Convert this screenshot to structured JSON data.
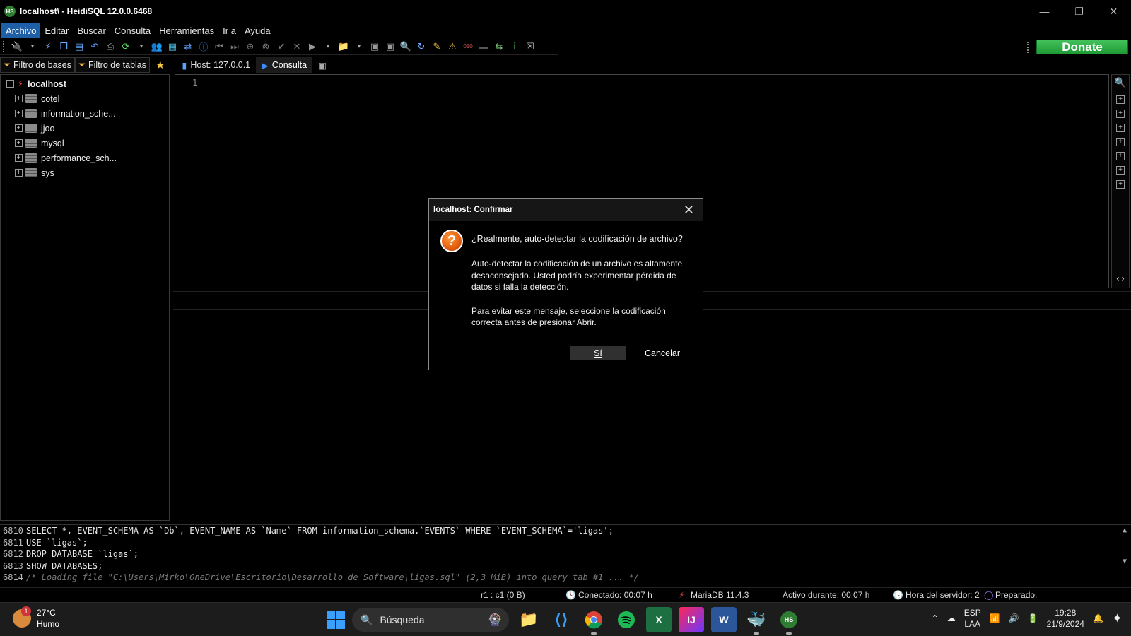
{
  "window": {
    "title": "localhost\\ - HeidiSQL 12.0.0.6468",
    "app_logo": "HS",
    "minimize": "—",
    "maximize": "❐",
    "close": "✕"
  },
  "menu": [
    "Archivo",
    "Editar",
    "Buscar",
    "Consulta",
    "Herramientas",
    "Ir a",
    "Ayuda"
  ],
  "toolbar": {
    "icons": [
      "connect-icon",
      "disconnect-icon",
      "copy-icon",
      "paste-icon",
      "undo-icon",
      "print-icon",
      "refresh-icon",
      "users-icon",
      "export-icon",
      "sync-icon",
      "help-icon",
      "first-icon",
      "last-icon",
      "add-icon",
      "cancel-icon",
      "apply-icon",
      "delete-icon",
      "run-icon",
      "open-folder-icon",
      "save-icon",
      "search-icon",
      "replace-icon",
      "clean-icon",
      "warning-icon"
    ],
    "donate_label": "Donate"
  },
  "tabs": {
    "filter_databases": "Filtro de bases",
    "filter_tables": "Filtro de tablas",
    "host_tab": "Host: 127.0.0.1",
    "query_tab": "Consulta"
  },
  "tree": {
    "host": "localhost",
    "databases": [
      "cotel",
      "information_sche...",
      "jjoo",
      "mysql",
      "performance_sch...",
      "sys"
    ]
  },
  "editor": {
    "line_number": "1"
  },
  "log": [
    {
      "num": "6810",
      "text": "SELECT *, EVENT_SCHEMA AS `Db`, EVENT_NAME AS `Name` FROM information_schema.`EVENTS` WHERE `EVENT_SCHEMA`='ligas';"
    },
    {
      "num": "6811",
      "text": "USE `ligas`;"
    },
    {
      "num": "6812",
      "text": "DROP DATABASE `ligas`;"
    },
    {
      "num": "6813",
      "text": "SHOW DATABASES;"
    },
    {
      "num": "6814",
      "text": "/* Loading file \"C:\\Users\\Mirko\\OneDrive\\Escritorio\\Desarrollo de Software\\ligas.sql\" (2,3 MiB) into query tab #1 ... */"
    }
  ],
  "status": {
    "cursor": "r1 : c1 (0 B)",
    "connected": "Conectado: 00:07 h",
    "server": "MariaDB 11.4.3",
    "uptime": "Activo durante: 00:07 h",
    "server_time": "Hora del servidor: 2",
    "state": "Preparado."
  },
  "dialog": {
    "title": "localhost: Confirmar",
    "question": "¿Realmente, auto-detectar la codificación de archivo?",
    "body1": "Auto-detectar la codificación de un archivo es altamente desaconsejado. Usted podría experimentar pérdida de datos si falla la detección.",
    "body2": "Para evitar este mensaje, seleccione la codificación correcta antes de presionar Abrir.",
    "yes": "Sí",
    "cancel": "Cancelar"
  },
  "taskbar": {
    "temperature": "27°C",
    "weather": "Humo",
    "weather_badge": "1",
    "search": "Búsqueda",
    "lang1": "ESP",
    "lang2": "LAA",
    "time": "19:28",
    "date": "21/9/2024"
  }
}
